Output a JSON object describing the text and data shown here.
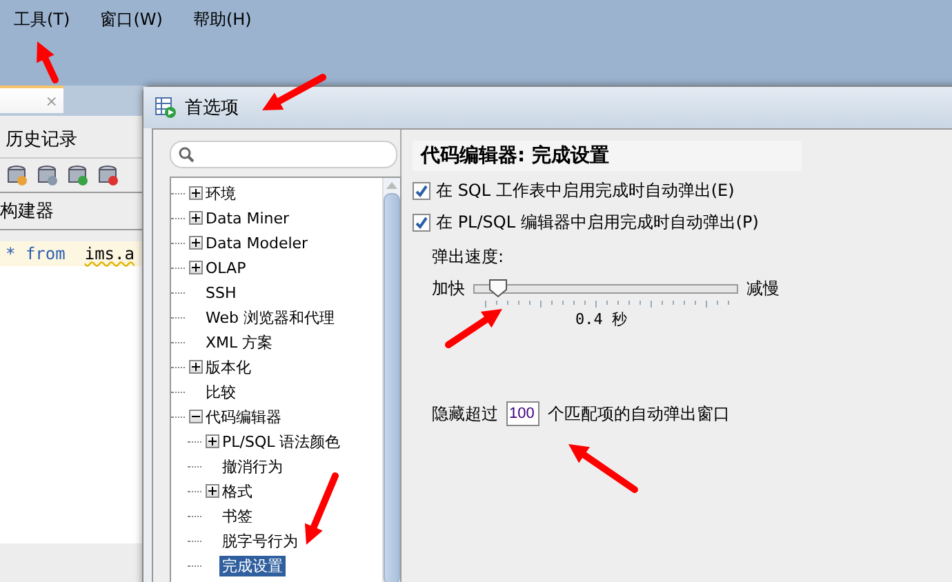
{
  "menu_bar": {
    "items": [
      "工具(T)",
      "窗口(W)",
      "帮助(H)"
    ]
  },
  "background_panel": {
    "tab_close": "×",
    "title": "历史记录",
    "section": "构建器",
    "editor_line": {
      "keyword": "* from",
      "text": "ims.a"
    }
  },
  "dialog": {
    "title": "首选项",
    "tree": [
      {
        "label": "环境",
        "expanded": false,
        "selected": false
      },
      {
        "label": "Data Miner",
        "expanded": false,
        "selected": false
      },
      {
        "label": "Data Modeler",
        "expanded": false,
        "selected": false
      },
      {
        "label": "OLAP",
        "expanded": false,
        "selected": false
      },
      {
        "label": "SSH",
        "selected": false
      },
      {
        "label": "Web 浏览器和代理",
        "selected": false
      },
      {
        "label": "XML 方案",
        "selected": false
      },
      {
        "label": "版本化",
        "expanded": false,
        "selected": false
      },
      {
        "label": "比较",
        "selected": false
      },
      {
        "label": "代码编辑器",
        "expanded": true,
        "selected": false,
        "children": [
          {
            "label": "PL/SQL 语法颜色",
            "expanded": false,
            "selected": false
          },
          {
            "label": "撤消行为",
            "selected": false
          },
          {
            "label": "格式",
            "expanded": false,
            "selected": false
          },
          {
            "label": "书签",
            "selected": false
          },
          {
            "label": "脱字号行为",
            "selected": false
          },
          {
            "label": "完成设置",
            "selected": true
          }
        ]
      }
    ],
    "heading": "代码编辑器: 完成设置",
    "checkboxes": [
      {
        "label": "在 SQL 工作表中启用完成时自动弹出(E)",
        "checked": true
      },
      {
        "label": "在 PL/SQL 编辑器中启用完成时自动弹出(P)",
        "checked": true
      }
    ],
    "speed": {
      "label": "弹出速度:",
      "min_label": "加快",
      "max_label": "减慢",
      "level": 0.09,
      "reading": "0.4 秒"
    },
    "hide": {
      "before": "隐藏超过",
      "value": "100",
      "after": "个匹配项的自动弹出窗口"
    }
  }
}
